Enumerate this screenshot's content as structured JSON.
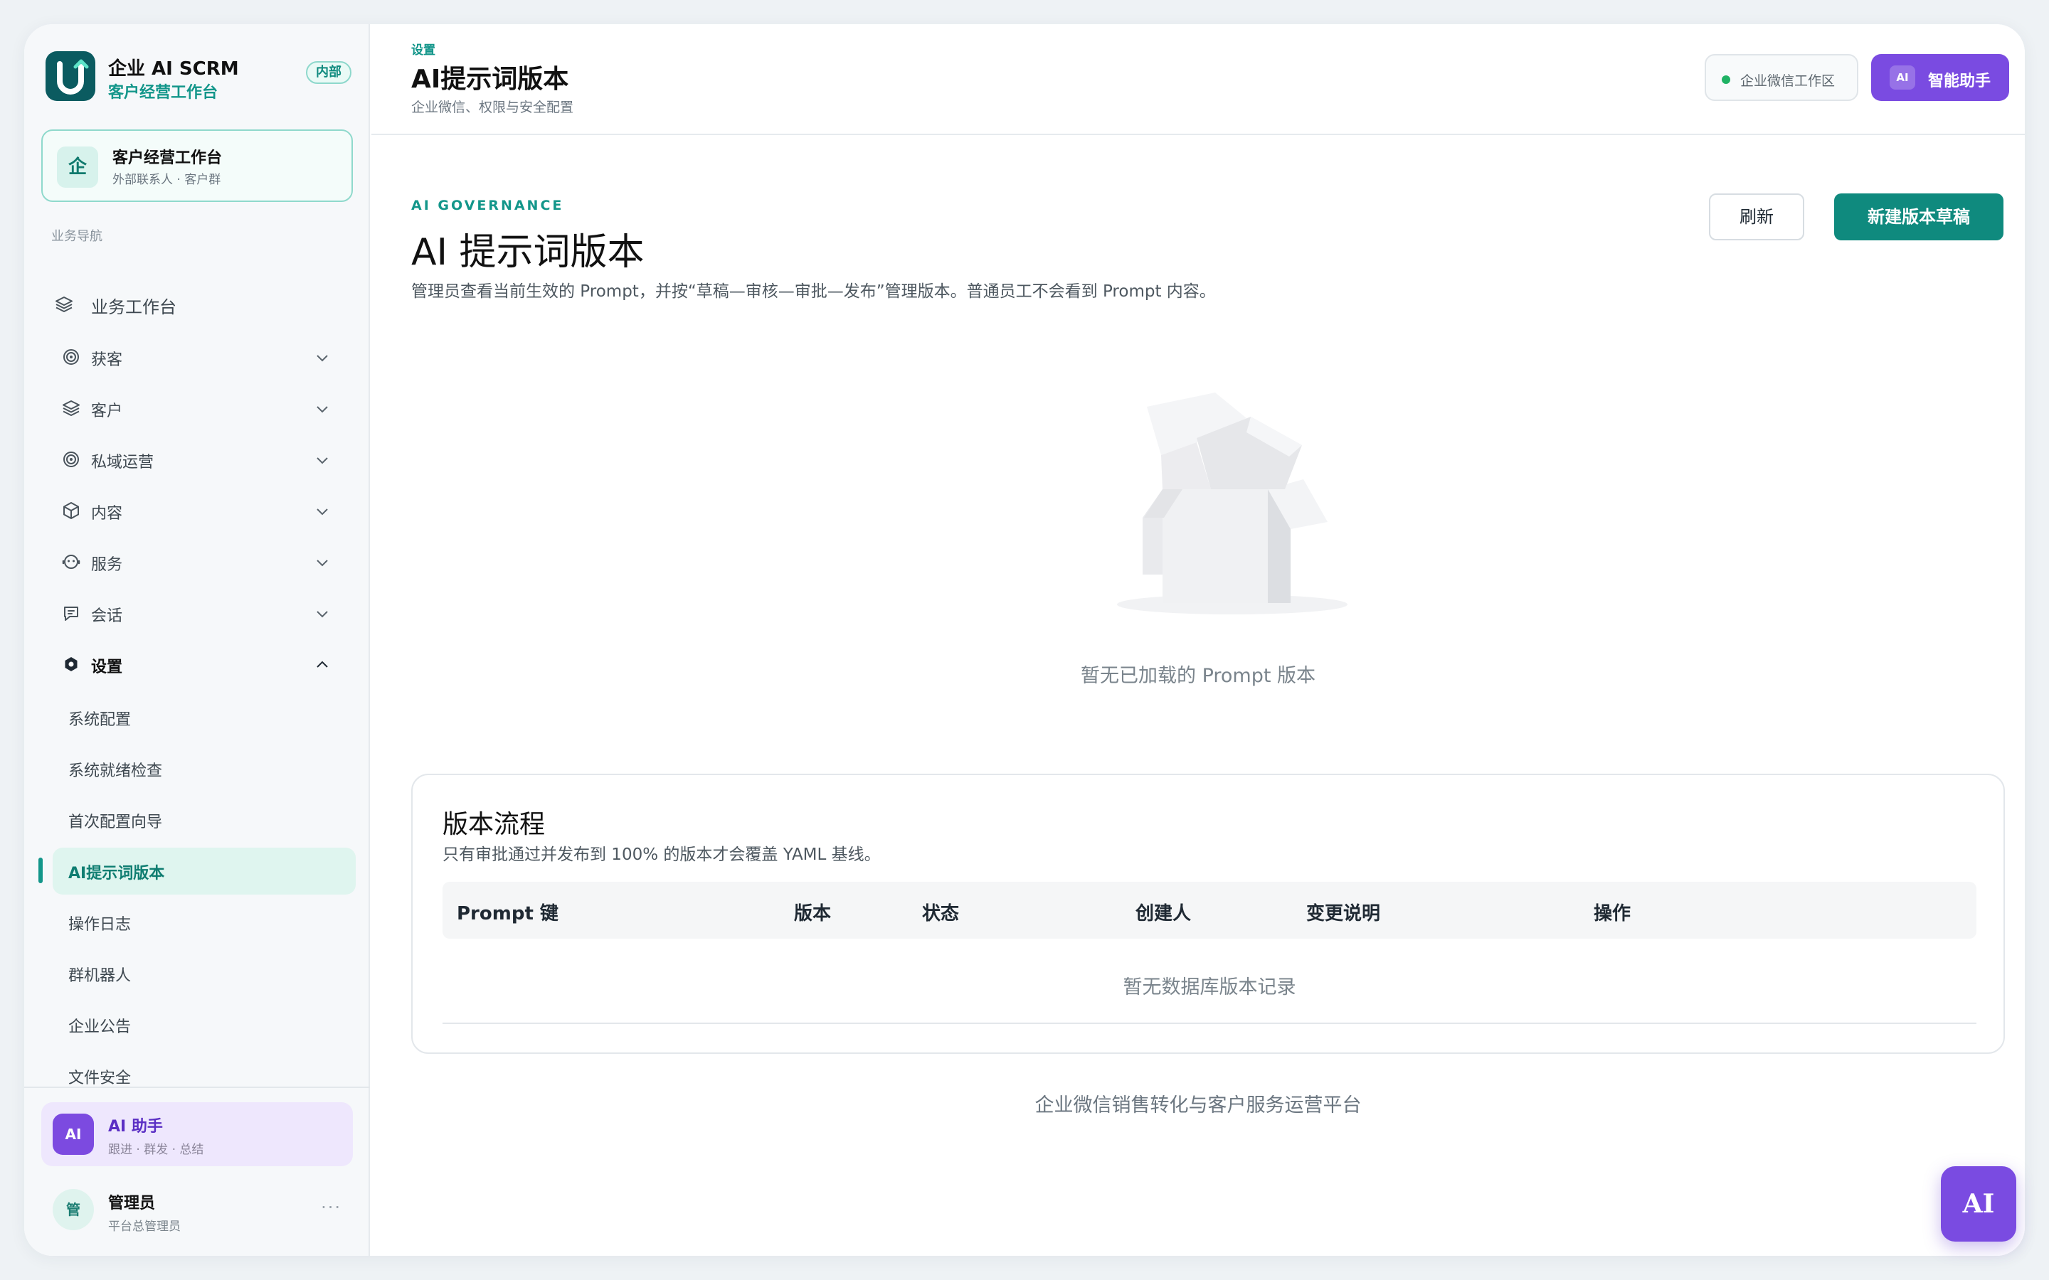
{
  "brand": {
    "name": "企业 AI SCRM",
    "subtitle": "客户经营工作台",
    "tag": "内部"
  },
  "workspace": {
    "icon_char": "企",
    "title": "客户经营工作台",
    "subtitle": "外部联系人 · 客户群"
  },
  "nav": {
    "section_label": "业务导航",
    "top_item": {
      "label": "业务工作台",
      "icon": "layers-icon"
    },
    "groups": [
      {
        "label": "获客",
        "icon": "target-icon",
        "expanded": false
      },
      {
        "label": "客户",
        "icon": "layers-icon",
        "expanded": false
      },
      {
        "label": "私域运营",
        "icon": "target-icon",
        "expanded": false
      },
      {
        "label": "内容",
        "icon": "box-icon",
        "expanded": false
      },
      {
        "label": "服务",
        "icon": "support-icon",
        "expanded": false
      },
      {
        "label": "会话",
        "icon": "chat-icon",
        "expanded": false
      },
      {
        "label": "设置",
        "icon": "settings-icon",
        "expanded": true
      }
    ],
    "settings_items": [
      {
        "label": "系统配置"
      },
      {
        "label": "系统就绪检查"
      },
      {
        "label": "首次配置向导"
      },
      {
        "label": "AI提示词版本",
        "active": true
      },
      {
        "label": "操作日志"
      },
      {
        "label": "群机器人"
      },
      {
        "label": "企业公告"
      },
      {
        "label": "文件安全"
      }
    ]
  },
  "ai_card": {
    "badge": "AI",
    "title": "AI 助手",
    "subtitle": "跟进 · 群发 · 总结"
  },
  "user": {
    "avatar_char": "管",
    "name": "管理员",
    "role": "平台总管理员",
    "more": "···"
  },
  "header": {
    "breadcrumb": "设置",
    "title": "AI提示词版本",
    "subtitle": "企业微信、权限与安全配置",
    "workspace_pill": "企业微信工作区",
    "assistant_badge": "AI",
    "assistant_label": "智能助手"
  },
  "page": {
    "eyebrow": "AI GOVERNANCE",
    "title": "AI 提示词版本",
    "description": "管理员查看当前生效的 Prompt，并按“草稿—审核—审批—发布”管理版本。普通员工不会看到 Prompt 内容。",
    "refresh_label": "刷新",
    "new_draft_label": "新建版本草稿",
    "empty_text": "暂无已加载的 Prompt 版本"
  },
  "flow": {
    "title": "版本流程",
    "subtitle": "只有审批通过并发布到 100% 的版本才会覆盖 YAML 基线。",
    "columns": [
      "Prompt 键",
      "版本",
      "状态",
      "创建人",
      "变更说明",
      "操作"
    ],
    "empty_text": "暂无数据库版本记录"
  },
  "footer": {
    "text": "企业微信销售转化与客户服务运营平台"
  },
  "fab": {
    "label": "AI"
  },
  "colors": {
    "brand_teal": "#0f8a7e",
    "accent_purple": "#7a4be1",
    "active_bg": "#dff5ef",
    "status_green": "#1fb264"
  }
}
